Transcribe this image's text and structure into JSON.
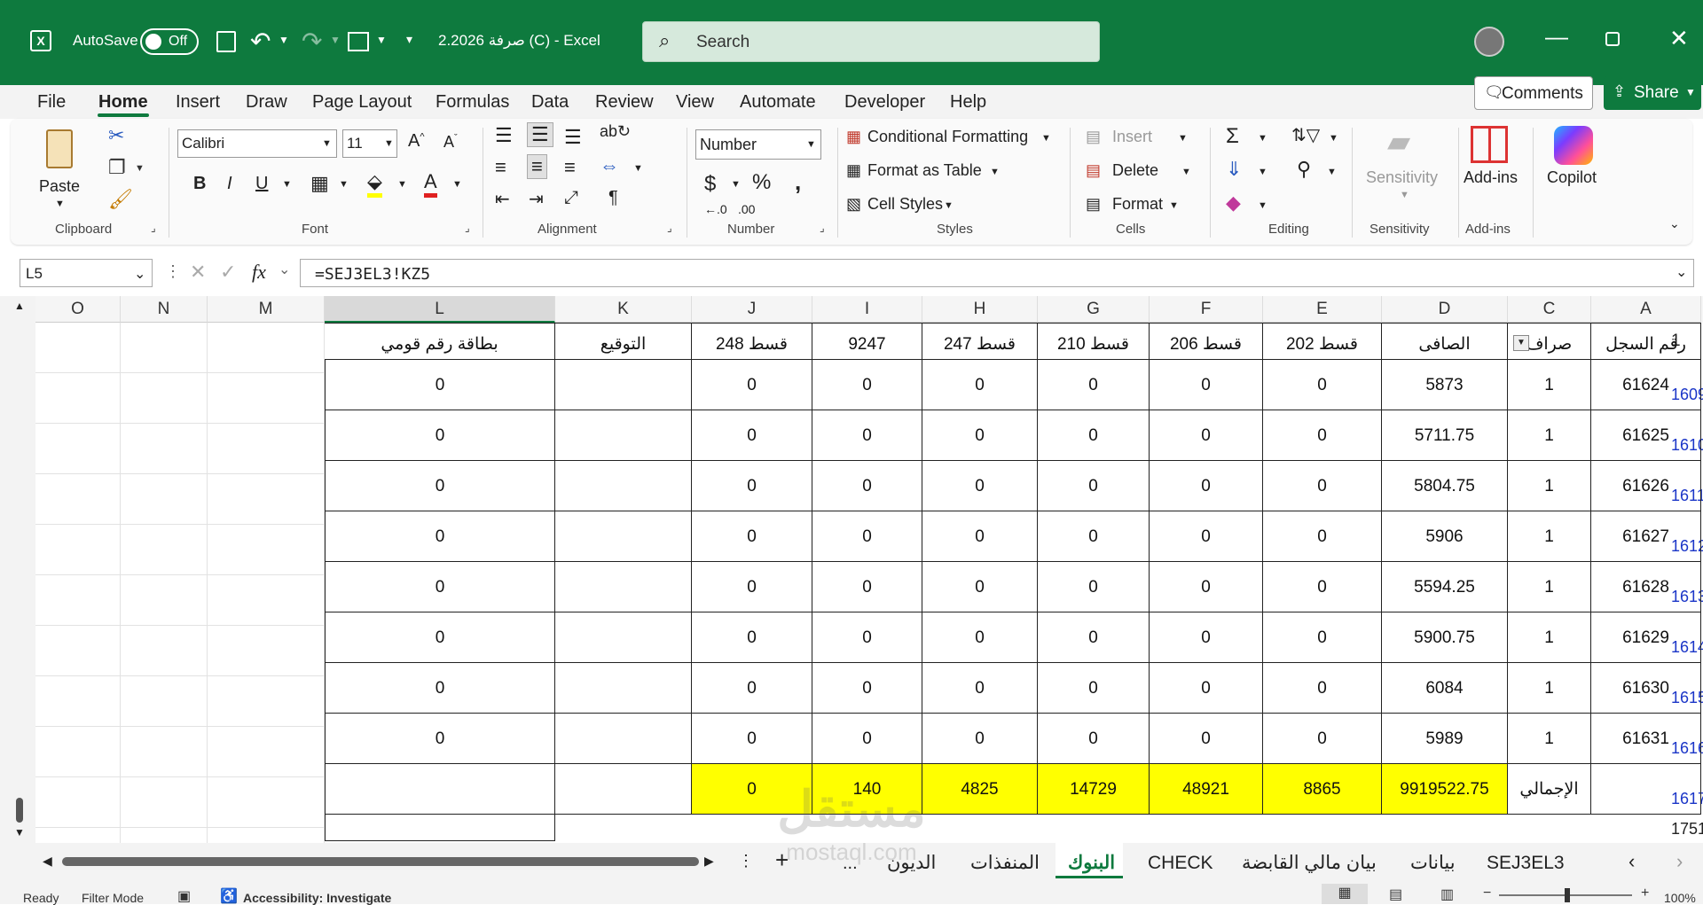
{
  "titlebar": {
    "autosave_label": "AutoSave",
    "autosave_state": "Off",
    "title": "2.2026 صرفة (C)  -  Excel",
    "search_placeholder": "Search",
    "colors": {
      "bar": "#0e7a3e",
      "search_bg": "#d6e9dc"
    }
  },
  "menu": {
    "items": [
      "File",
      "Home",
      "Insert",
      "Draw",
      "Page Layout",
      "Formulas",
      "Data",
      "Review",
      "View",
      "Automate",
      "Developer",
      "Help"
    ],
    "active": "Home",
    "comments_label": "Comments",
    "share_label": "Share"
  },
  "ribbon": {
    "clipboard": {
      "paste_label": "Paste",
      "group_label": "Clipboard"
    },
    "font": {
      "font_name": "Calibri",
      "font_size": "11",
      "group_label": "Font"
    },
    "alignment": {
      "group_label": "Alignment"
    },
    "number": {
      "format": "Number",
      "group_label": "Number"
    },
    "styles": {
      "conditional": "Conditional Formatting",
      "format_table": "Format as Table",
      "cell_styles": "Cell Styles",
      "group_label": "Styles"
    },
    "cells": {
      "insert": "Insert",
      "delete": "Delete",
      "format": "Format",
      "group_label": "Cells"
    },
    "editing": {
      "group_label": "Editing"
    },
    "sensitivity": {
      "label": "Sensitivity",
      "group_label": "Sensitivity"
    },
    "addins": {
      "label": "Add-ins",
      "group_label": "Add-ins"
    },
    "copilot": {
      "label": "Copilot"
    }
  },
  "formula_bar": {
    "name_box": "L5",
    "fx": "fx",
    "formula": "=SEJ3EL3!KZ5"
  },
  "grid": {
    "col_letters": [
      "O",
      "N",
      "M",
      "L",
      "K",
      "J",
      "I",
      "H",
      "G",
      "F",
      "E",
      "D",
      "C",
      "A"
    ],
    "header_row_num": "1",
    "headers": {
      "L": "بطاقة رقم قومي",
      "K": "التوقيع",
      "J": "قسط 248",
      "I": "9247",
      "H": "قسط 247",
      "G": "قسط 210",
      "F": "قسط 206",
      "E": "قسط 202",
      "D": "الصافى",
      "C": "صراف",
      "A": "رقم السجل"
    },
    "rows": [
      {
        "num": "1609",
        "L": "0",
        "J": "0",
        "I": "0",
        "H": "0",
        "G": "0",
        "F": "0",
        "E": "0",
        "D": "5873",
        "C": "1",
        "A": "61624"
      },
      {
        "num": "1610",
        "L": "0",
        "J": "0",
        "I": "0",
        "H": "0",
        "G": "0",
        "F": "0",
        "E": "0",
        "D": "5711.75",
        "C": "1",
        "A": "61625"
      },
      {
        "num": "1611",
        "L": "0",
        "J": "0",
        "I": "0",
        "H": "0",
        "G": "0",
        "F": "0",
        "E": "0",
        "D": "5804.75",
        "C": "1",
        "A": "61626"
      },
      {
        "num": "1612",
        "L": "0",
        "J": "0",
        "I": "0",
        "H": "0",
        "G": "0",
        "F": "0",
        "E": "0",
        "D": "5906",
        "C": "1",
        "A": "61627"
      },
      {
        "num": "1613",
        "L": "0",
        "J": "0",
        "I": "0",
        "H": "0",
        "G": "0",
        "F": "0",
        "E": "0",
        "D": "5594.25",
        "C": "1",
        "A": "61628"
      },
      {
        "num": "1614",
        "L": "0",
        "J": "0",
        "I": "0",
        "H": "0",
        "G": "0",
        "F": "0",
        "E": "0",
        "D": "5900.75",
        "C": "1",
        "A": "61629"
      },
      {
        "num": "1615",
        "L": "0",
        "J": "0",
        "I": "0",
        "H": "0",
        "G": "0",
        "F": "0",
        "E": "0",
        "D": "6084",
        "C": "1",
        "A": "61630"
      },
      {
        "num": "1616",
        "L": "0",
        "J": "0",
        "I": "0",
        "H": "0",
        "G": "0",
        "F": "0",
        "E": "0",
        "D": "5989",
        "C": "1",
        "A": "61631"
      }
    ],
    "total_row": {
      "num": "1617",
      "J": "0",
      "I": "140",
      "H": "4825",
      "G": "14729",
      "F": "48921",
      "E": "8865",
      "D": "9919522.75",
      "C": "الإجمالي"
    },
    "last_row_num": "1751",
    "highlight_color": "#ffff00"
  },
  "sheet_tabs": {
    "tabs": [
      "الديون",
      "المنفذات",
      "البنوك",
      "CHECK",
      "بيان مالي القابضة",
      "بيانات",
      "SEJ3EL3"
    ],
    "active": "البنوك",
    "overflow": "..."
  },
  "status": {
    "ready": "Ready",
    "mode": "Filter Mode",
    "accessibility": "Accessibility: Investigate",
    "zoom": "100%"
  },
  "watermark": {
    "text": "مستقل",
    "url": "mostaql.com"
  }
}
